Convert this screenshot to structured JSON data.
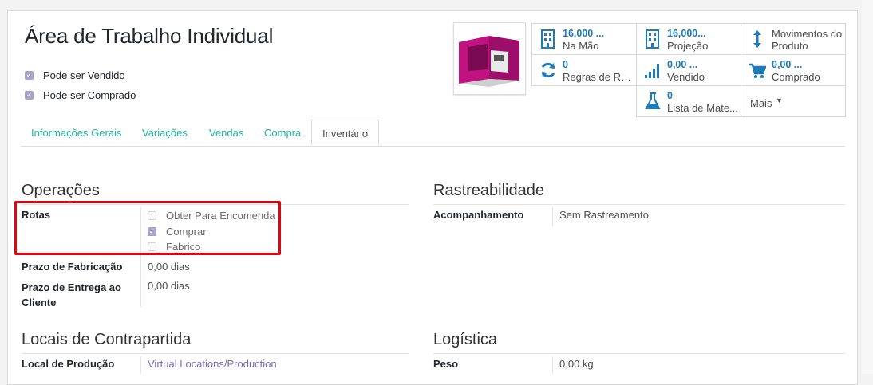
{
  "product": {
    "title": "Área de Trabalho Individual",
    "can_be_sold": "Pode ser Vendido",
    "can_be_purchased": "Pode ser Comprado"
  },
  "smart_buttons": {
    "on_hand": {
      "value": "16,000 ...",
      "label": "Na Mão"
    },
    "forecast": {
      "value": "16,000...",
      "label": "Projeção"
    },
    "moves": {
      "label": "Movimentos do Produto"
    },
    "reorder": {
      "value": "0",
      "label": "Regras de Re..."
    },
    "sold": {
      "value": "0,00 ...",
      "label": "Vendido"
    },
    "purchased": {
      "value": "0,00 ...",
      "label": "Comprado"
    },
    "bom": {
      "value": "0",
      "label": "Lista de Mate..."
    },
    "more": {
      "label": "Mais"
    }
  },
  "tabs": [
    "Informações Gerais",
    "Variações",
    "Vendas",
    "Compra",
    "Inventário"
  ],
  "operations": {
    "heading": "Operações",
    "routes_label": "Rotas",
    "routes": [
      {
        "label": "Obter Para Encomenda",
        "checked": false
      },
      {
        "label": "Comprar",
        "checked": true
      },
      {
        "label": "Fabrico",
        "checked": false
      }
    ],
    "manufacture_lead_label": "Prazo de Fabricação",
    "manufacture_lead_value": "0,00 dias",
    "customer_lead_label": "Prazo de Entrega ao Cliente",
    "customer_lead_value": "0,00 dias"
  },
  "traceability": {
    "heading": "Rastreabilidade",
    "tracking_label": "Acompanhamento",
    "tracking_value": "Sem Rastreamento"
  },
  "counterpart": {
    "heading": "Locais de Contrapartida",
    "production_label": "Local de Produção",
    "production_value": "Virtual Locations/Production"
  },
  "logistics": {
    "heading": "Logística",
    "weight_label": "Peso",
    "weight_value": "0,00 kg"
  },
  "colors": {
    "link": "#7c6bb3",
    "tab": "#21b799",
    "stat": "#1f7ab8",
    "highlight": "#e2050f",
    "checkbox": "#a9a3cc"
  }
}
